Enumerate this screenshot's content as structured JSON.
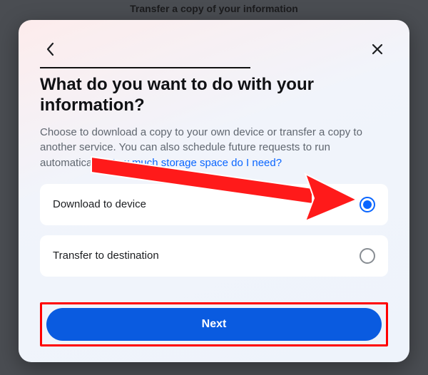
{
  "background": {
    "title": "Transfer a copy of your information"
  },
  "modal": {
    "heading": "What do you want to do with your information?",
    "subtext_a": "Choose to download a copy to your own device or transfer a copy to another service. You can also schedule future requests to run automatically. ",
    "link_text": "How much storage space do I need?",
    "options": [
      {
        "label": "Download to device",
        "selected": true
      },
      {
        "label": "Transfer to destination",
        "selected": false
      }
    ],
    "next_label": "Next"
  }
}
